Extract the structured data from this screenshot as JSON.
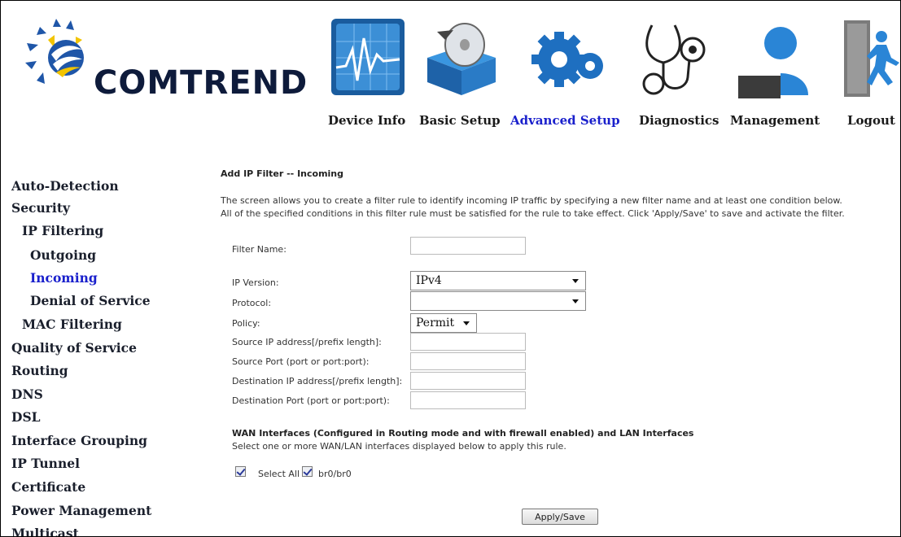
{
  "brand": {
    "name": "COMTREND"
  },
  "nav": [
    {
      "label": "Device Info",
      "icon": "chart-icon",
      "active": false
    },
    {
      "label": "Basic Setup",
      "icon": "cd-box-icon",
      "active": false
    },
    {
      "label": "Advanced Setup",
      "icon": "gears-icon",
      "active": true
    },
    {
      "label": "Diagnostics",
      "icon": "stethoscope-icon",
      "active": false
    },
    {
      "label": "Management",
      "icon": "admin-icon",
      "active": false
    },
    {
      "label": "Logout",
      "icon": "exit-icon",
      "active": false
    }
  ],
  "sidebar": [
    {
      "label": "Auto-Detection"
    },
    {
      "label": "Security"
    },
    {
      "label": "IP Filtering"
    },
    {
      "label": "Outgoing"
    },
    {
      "label": "Incoming",
      "active": true
    },
    {
      "label": "Denial of Service"
    },
    {
      "label": "MAC Filtering"
    },
    {
      "label": "Quality of Service"
    },
    {
      "label": "Routing"
    },
    {
      "label": "DNS"
    },
    {
      "label": "DSL"
    },
    {
      "label": "Interface Grouping"
    },
    {
      "label": "IP Tunnel"
    },
    {
      "label": "Certificate"
    },
    {
      "label": "Power Management"
    },
    {
      "label": "Multicast"
    }
  ],
  "form": {
    "title": "Add IP Filter -- Incoming",
    "description_line1": "The screen allows you to create a filter rule to identify incoming IP traffic by specifying a new filter name and at least one condition below.",
    "description_line2": "All of the specified conditions in this filter rule must be satisfied for the rule to take effect. Click 'Apply/Save' to save and activate the filter.",
    "filter_name_label": "Filter Name:",
    "filter_name_value": "",
    "ip_version_label": "IP Version:",
    "ip_version_value": "IPv4",
    "protocol_label": "Protocol:",
    "protocol_value": "",
    "policy_label": "Policy:",
    "policy_value": "Permit",
    "src_ip_label": "Source IP address[/prefix length]:",
    "src_port_label": "Source Port (port or port:port):",
    "dst_ip_label": "Destination IP address[/prefix length]:",
    "dst_port_label": "Destination Port (port or port:port):",
    "wan_heading": "WAN Interfaces (Configured in Routing mode and with firewall enabled) and LAN Interfaces",
    "wan_sub": "Select one or more WAN/LAN interfaces displayed below to apply this rule.",
    "select_all_label": "Select All",
    "iface_label": "br0/br0",
    "apply_label": "Apply/Save"
  },
  "colors": {
    "active": "#1a20cc",
    "brand": "#0e1b3b"
  }
}
